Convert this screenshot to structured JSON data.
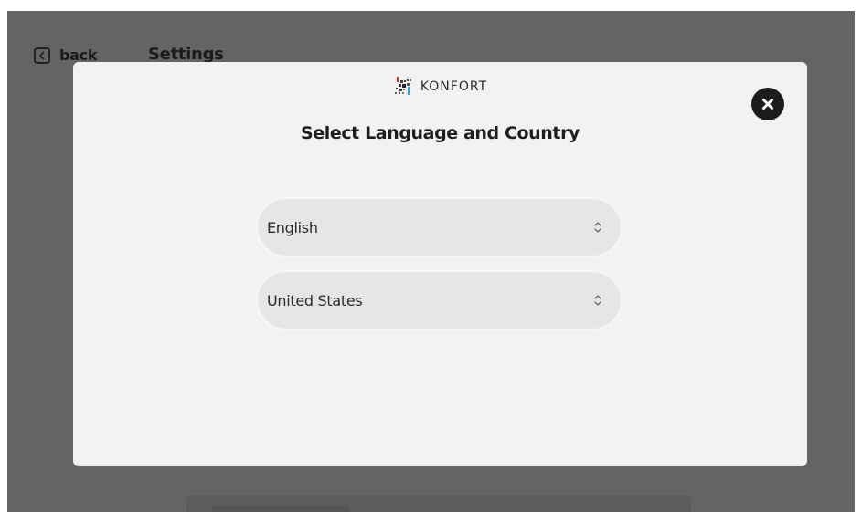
{
  "header": {
    "back_label": "back",
    "title": "Settings"
  },
  "modal": {
    "brand_name": "KONFORT",
    "title": "Select Language and Country",
    "language_select": {
      "selected": "English"
    },
    "country_select": {
      "selected": "United States"
    }
  },
  "icons": {
    "back": "chevron-left-icon",
    "close": "close-circle-icon",
    "brand": "konfort-logo-icon",
    "select_arrow": "up-down-chevron-icon"
  },
  "colors": {
    "overlay": "#646464",
    "modal_background": "#f2f2f2",
    "select_background": "#e6e6e6",
    "close_button": "#1c1c1c",
    "text": "#1e1e1e"
  }
}
